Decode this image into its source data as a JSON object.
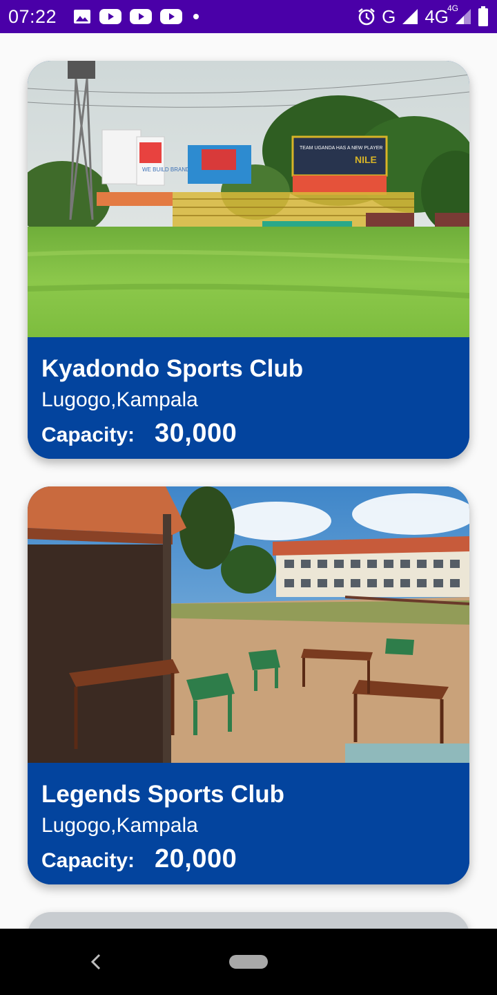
{
  "status_bar": {
    "time": "07:22",
    "left_icons": [
      "image-icon",
      "youtube-icon",
      "youtube-icon",
      "youtube-icon",
      "dot-icon"
    ],
    "network_g": "G",
    "network_4g": "4G",
    "network_4g_sup": "4G",
    "right_icons": [
      "alarm-icon",
      "signal-icon",
      "signal-icon",
      "battery-icon"
    ]
  },
  "clubs": [
    {
      "name": "Kyadondo Sports Club",
      "location": "Lugogo,Kampala",
      "capacity_label": "Capacity:",
      "capacity_value": "30,000",
      "photo_billboards": {
        "b1": "WE BUILD BRANDS",
        "b2": "TEAM UGANDA HAS A NEW PLAYER",
        "b3": "NILE"
      }
    },
    {
      "name": "Legends Sports Club",
      "location": "Lugogo,Kampala",
      "capacity_label": "Capacity:",
      "capacity_value": "20,000"
    }
  ],
  "colors": {
    "status_bar": "#4a00a8",
    "card_info": "#03449e",
    "background": "#fafafa",
    "nav_bar": "#000000"
  },
  "nav": {
    "icons": [
      "back-icon",
      "home-pill-icon"
    ]
  }
}
